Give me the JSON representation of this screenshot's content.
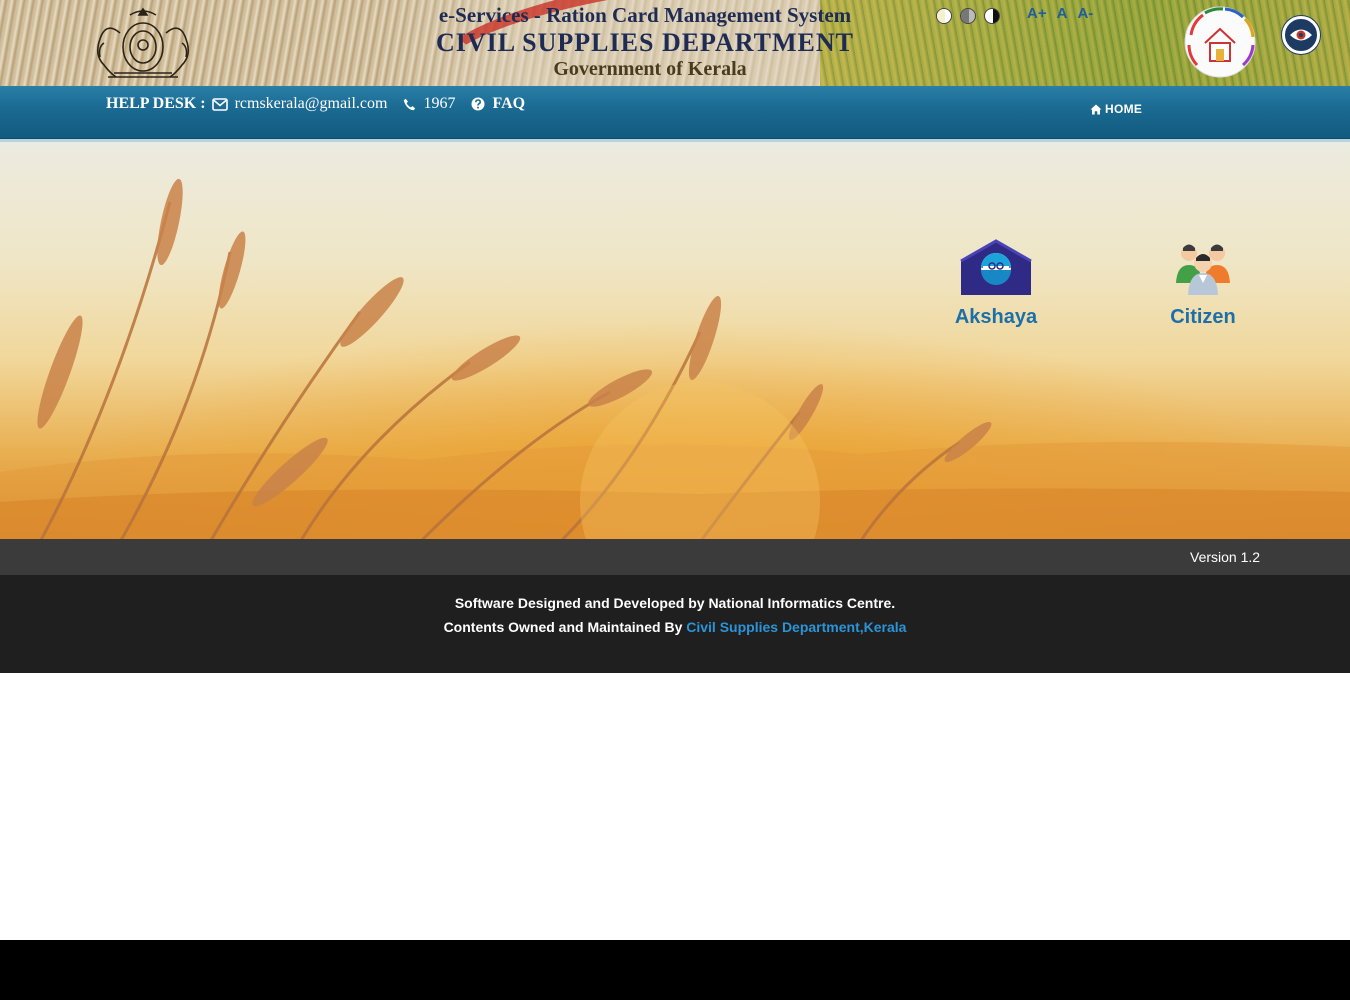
{
  "header": {
    "title_line1": "e-Services - Ration Card Management System",
    "title_line2": "CIVIL SUPPLIES DEPARTMENT",
    "title_line3": "Government of Kerala",
    "font_controls": [
      "A+",
      "A",
      "A-"
    ],
    "contrast_controls": [
      "contrast-light-icon",
      "contrast-gray-icon",
      "contrast-dark-icon"
    ]
  },
  "navbar": {
    "helpdesk_label": "HELP DESK :",
    "email": "rcmskerala@gmail.com",
    "phone": "1967",
    "faq": "FAQ",
    "home": "HOME"
  },
  "portals": [
    {
      "label": "Akshaya",
      "icon": "akshaya-house-icon"
    },
    {
      "label": "Citizen",
      "icon": "citizen-group-icon"
    }
  ],
  "version": "Version 1.2",
  "footer": {
    "line1": "Software Designed and Developed by National Informatics Centre.",
    "line2_prefix": "Contents Owned and Maintained By ",
    "line2_link": "Civil Supplies Department,Kerala"
  },
  "colors": {
    "navbar": "#1b6b93",
    "portal_label": "#1c6fa8",
    "footer_link": "#2b94d8",
    "title": "#1d2b55"
  }
}
